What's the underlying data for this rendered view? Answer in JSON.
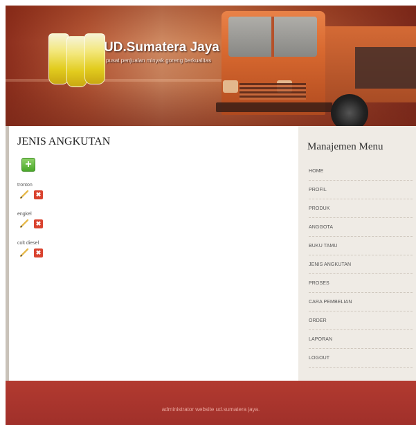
{
  "header": {
    "brand_title": "UD.Sumatera Jaya",
    "brand_subtitle": "pusat penjualan minyak goreng berkualitas"
  },
  "main": {
    "title": "JENIS ANGKUTAN",
    "add_icon": "plus-icon",
    "items": [
      {
        "name": "tronton"
      },
      {
        "name": "engkel"
      },
      {
        "name": "colt diesel"
      }
    ]
  },
  "sidebar": {
    "title": "Manajemen Menu",
    "items": [
      {
        "label": "HOME"
      },
      {
        "label": "PROFIL"
      },
      {
        "label": "PRODUK"
      },
      {
        "label": "ANGGOTA"
      },
      {
        "label": "BUKU TAMU"
      },
      {
        "label": "JENIS ANGKUTAN"
      },
      {
        "label": "PROSES"
      },
      {
        "label": "CARA PEMBELIAN"
      },
      {
        "label": "ORDER"
      },
      {
        "label": "LAPORAN"
      },
      {
        "label": "LOGOUT"
      }
    ]
  },
  "footer": {
    "text": "administrator website ud.sumatera jaya."
  },
  "colors": {
    "footer": "#a0302a",
    "sidebar": "#efebe5",
    "add_button": "#4aa82a",
    "delete_button": "#d9432f"
  }
}
